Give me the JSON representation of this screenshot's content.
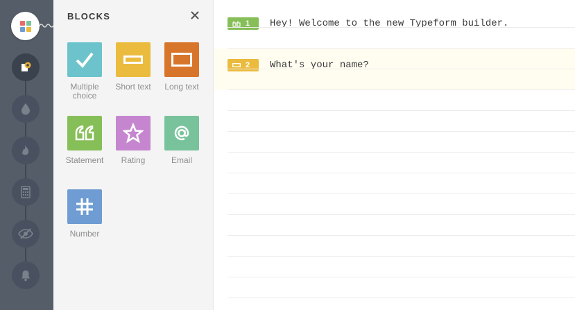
{
  "panel": {
    "title": "BLOCKS",
    "blocks": [
      {
        "label": "Multiple\nchoice",
        "icon": "checkmark-icon",
        "color": "#6cc3cb"
      },
      {
        "label": "Short text",
        "icon": "short-text-icon",
        "color": "#ebbb3e"
      },
      {
        "label": "Long text",
        "icon": "long-text-icon",
        "color": "#d7762b"
      },
      {
        "label": "Statement",
        "icon": "quote-icon",
        "color": "#86be57"
      },
      {
        "label": "Rating",
        "icon": "star-icon",
        "color": "#c586cf"
      },
      {
        "label": "Email",
        "icon": "at-sign-icon",
        "color": "#78c39b"
      },
      {
        "label": "Number",
        "icon": "hash-icon",
        "color": "#6f9cd2"
      }
    ]
  },
  "rail": {
    "items": [
      "settings-icon",
      "drop-icon",
      "flame-icon",
      "calculator-icon",
      "eye-icon",
      "bell-icon"
    ]
  },
  "questions": [
    {
      "number": "1",
      "text": "Hey! Welcome to the new Typeform builder.",
      "icon": "quote-icon",
      "color": "#86be57"
    },
    {
      "number": "2",
      "text": "What's your name?",
      "icon": "short-text-icon",
      "color": "#ebbb3e"
    }
  ],
  "logo_colors": [
    "#e86a6a",
    "#78c39b",
    "#6f9cd2",
    "#ebbb3e"
  ]
}
